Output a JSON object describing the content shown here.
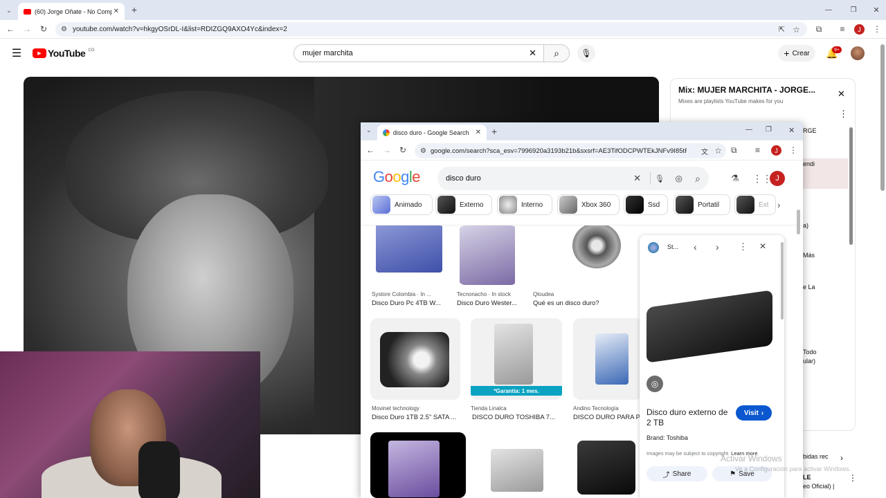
{
  "outer_browser": {
    "tab_title": "(60) Jorge Oñate - No Compren",
    "url": "youtube.com/watch?v=hkgyOSrDL-I&list=RDIZGQ9AXO4Yc&index=2",
    "profile_letter": "J"
  },
  "youtube": {
    "logo_text": "YouTube",
    "country_code": "CO",
    "search_value": "mujer marchita",
    "create_label": "Crear",
    "notif_badge": "9+"
  },
  "playlist": {
    "title": "Mix: MUJER MARCHITA - JORGE...",
    "subtitle": "Mixes are playlists YouTube makes for you",
    "fragments": [
      "RGE",
      "endi",
      "a)",
      "Más",
      "e La",
      "Todo",
      "ular)",
      "bidas rec",
      "LE",
      "eo Oficial) |"
    ]
  },
  "google_window": {
    "tab_title": "disco duro - Google Search",
    "url": "google.com/search?sca_esv=7996920a3193b21b&sxsrf=AE3TifODCPWTEkJNFv9I85tRQ...",
    "profile_letter": "J",
    "logo": "Google",
    "search_value": "disco duro",
    "chips": [
      "Animado",
      "Externo",
      "Interno",
      "Xbox 360",
      "Ssd",
      "Portatil",
      "Ext"
    ],
    "results": [
      {
        "source": "Systore Colombia · In ...",
        "title": "Disco Duro Pc 4TB W..."
      },
      {
        "source": "Tecnonacho · In stock",
        "title": "Disco Duro Wester..."
      },
      {
        "source": "Qloudea",
        "title": "Qué es un disco duro?"
      },
      {
        "source": "Movinet technology",
        "title": "Disco Duro 1TB 2.5\" SATA ..."
      },
      {
        "source": "Tienda Linalca",
        "title": "DISCO DURO TOSHIBA 7..."
      },
      {
        "source": "Andino Tecnología",
        "title": "DISCO DURO PARA P"
      }
    ],
    "garantia_banner": "*Garantía: 1 mes.",
    "panel": {
      "site_short": "St...",
      "product_title": "Disco duro externo de 2 TB",
      "visit_label": "Visit",
      "brand_label": "Brand:",
      "brand_value": "Toshiba",
      "copyright_note": "Images may be subject to copyright.",
      "learn_more": "Learn more",
      "share_label": "Share",
      "save_label": "Save"
    }
  },
  "windows_watermark": {
    "line1": "Activar Windows",
    "line2": "Ve a Configuración para activar Windows."
  }
}
